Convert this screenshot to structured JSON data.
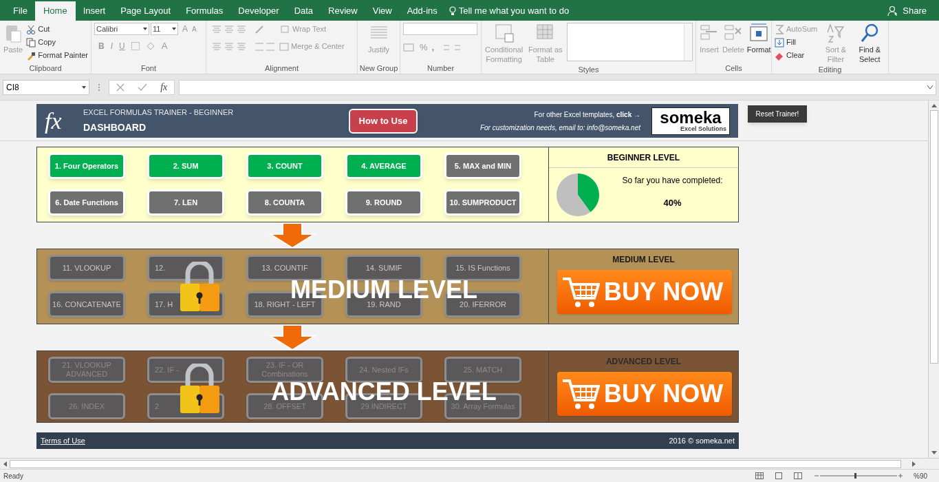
{
  "menu_tabs": [
    {
      "label": "File",
      "selected": false
    },
    {
      "label": "Home",
      "selected": true
    },
    {
      "label": "Insert",
      "selected": false
    },
    {
      "label": "Page Layout",
      "selected": false
    },
    {
      "label": "Formulas",
      "selected": false
    },
    {
      "label": "Developer",
      "selected": false
    },
    {
      "label": "Data",
      "selected": false
    },
    {
      "label": "Review",
      "selected": false
    },
    {
      "label": "View",
      "selected": false
    },
    {
      "label": "Add-ins",
      "selected": false
    }
  ],
  "tell_me": "Tell me what you want to do",
  "share": "Share",
  "ribbon": [
    {
      "kind": "clipboard",
      "label": "Clipboard",
      "paste": "Paste",
      "cut": "Cut",
      "copy": "Copy",
      "format_painter": "Format Painter"
    },
    {
      "kind": "font",
      "label": "Font",
      "font_name": "Calibri",
      "font_size": "11",
      "grow_font": "A",
      "shrink_font": "A",
      "bold": "B",
      "italic": "I",
      "underline": "U",
      "font_color": "A"
    },
    {
      "kind": "alignment",
      "label": "Alignment",
      "wrap_text": "Wrap Text",
      "merge_center": "Merge & Center"
    },
    {
      "kind": "new_group",
      "label": "New Group",
      "justify": "Justify"
    },
    {
      "kind": "number",
      "label": "Number",
      "percent": "%",
      "comma": ","
    },
    {
      "kind": "styles",
      "label": "Styles",
      "conditional_formatting": "Conditional Formatting",
      "format_as_table": "Format as Table"
    },
    {
      "kind": "cells",
      "label": "Cells",
      "insert": "Insert",
      "delete": "Delete",
      "format": "Format"
    },
    {
      "kind": "editing",
      "label": "Editing",
      "autosum": "AutoSum",
      "fill": "Fill",
      "clear": "Clear",
      "sort_filter": "Sort & Filter",
      "find_select": "Find & Select"
    }
  ],
  "formula_bar": {
    "name_box": "CI8",
    "function_label": "fx"
  },
  "header": {
    "logo": "fx",
    "title": "EXCEL FORMULAS TRAINER - BEGINNER",
    "subtitle": "DASHBOARD",
    "how_to_use": "How to Use",
    "promo": "For other Excel templates, **click** →",
    "email": "For customization needs, email to: info@someka.net",
    "brand": "someka",
    "brand_tagline": "Excel Solutions"
  },
  "reset_button": "Reset Trainer!",
  "levels": [
    {
      "kind": "beginner",
      "title": "BEGINNER LEVEL",
      "progress_text": "So far you have completed:",
      "percent": "40%",
      "chart_data": {
        "type": "pie",
        "values": [
          40,
          60
        ]
      },
      "lessons": [
        {
          "label": "1. Four Operators",
          "completed": true
        },
        {
          "label": "2. SUM",
          "completed": true
        },
        {
          "label": "3. COUNT",
          "completed": true
        },
        {
          "label": "4. AVERAGE",
          "completed": true
        },
        {
          "label": "5. MAX and MIN",
          "completed": false
        },
        {
          "label": "6. Date Functions",
          "completed": false
        },
        {
          "label": "7. LEN",
          "completed": false
        },
        {
          "label": "8. COUNTA",
          "completed": false
        },
        {
          "label": "9. ROUND",
          "completed": false
        },
        {
          "label": "10. SUMPRODUCT",
          "completed": false
        }
      ]
    },
    {
      "kind": "medium",
      "title": "MEDIUM LEVEL",
      "overlay": "MEDIUM LEVEL",
      "buy": "BUY NOW",
      "lessons": [
        {
          "label": "11. VLOOKUP"
        },
        {
          "label": "12.",
          "kind": "covered"
        },
        {
          "label": "13. COUNTIF"
        },
        {
          "label": "14. SUMIF"
        },
        {
          "label": "15. IS Functions"
        },
        {
          "label": "16. CONCATENATE"
        },
        {
          "label": "17. H",
          "kind": "covered"
        },
        {
          "label": "18. RIGHT - LEFT"
        },
        {
          "label": "19. RAND"
        },
        {
          "label": "20. IFERROR"
        }
      ]
    },
    {
      "kind": "advanced",
      "title": "ADVANCED LEVEL",
      "overlay": "ADVANCED LEVEL",
      "buy": "BUY NOW",
      "lessons": [
        {
          "label": "21. VLOOKUP ADVANCED"
        },
        {
          "label": "22. IF -",
          "kind": "covered"
        },
        {
          "label": "23. IF - OR Combinations"
        },
        {
          "label": "24. Nested IFs"
        },
        {
          "label": "25. MATCH"
        },
        {
          "label": "26. INDEX"
        },
        {
          "label": "2",
          "kind": "covered"
        },
        {
          "label": "28. OFFSET"
        },
        {
          "label": "29.INDIRECT"
        },
        {
          "label": "30. Array Formulas"
        }
      ]
    }
  ],
  "footer": {
    "terms": "Terms of Use",
    "copyright": "2016 © someka.net"
  },
  "status_bar": {
    "ready": "Ready",
    "zoom": "%90"
  }
}
